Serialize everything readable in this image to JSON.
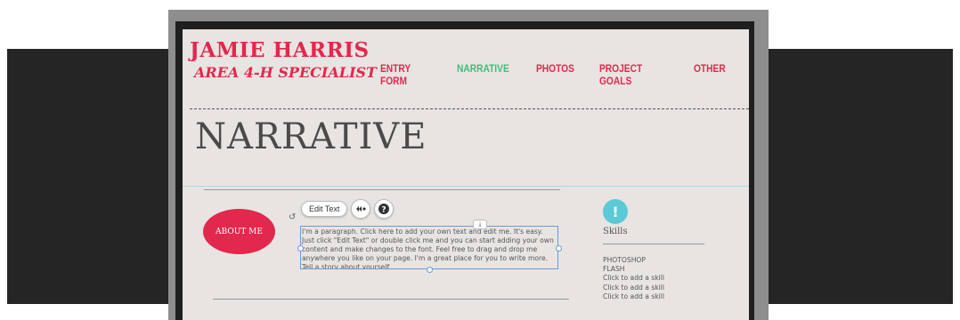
{
  "site": {
    "name": "JAMIE HARRIS",
    "title": "AREA 4-H SPECIALIST"
  },
  "nav": {
    "items": [
      "ENTRY FORM",
      "NARRATIVE",
      "PHOTOS",
      "PROJECT GOALS",
      "OTHER"
    ],
    "active": "NARRATIVE"
  },
  "page": {
    "title": "NARRATIVE"
  },
  "about": {
    "badge": "ABOUT ME",
    "edit_text_label": "Edit Text",
    "paragraph": "I'm a paragraph. Click here to add your own text and edit me. It's easy. Just click \"Edit Text\" or double click me and you can start adding your own content and make changes to the font. Feel free to drag and drop me anywhere you like on your page. I'm a great place for you to write more. Tell a story about yourself."
  },
  "skills": {
    "title": "Skills",
    "items": [
      "PHOTOSHOP",
      "FLASH",
      "Click to add a skill",
      "Click to add a skill",
      "Click to add a skill"
    ]
  },
  "colors": {
    "accent": "#e2284d",
    "active_nav": "#3fbf7a",
    "skills_icon": "#5bc9d6"
  }
}
